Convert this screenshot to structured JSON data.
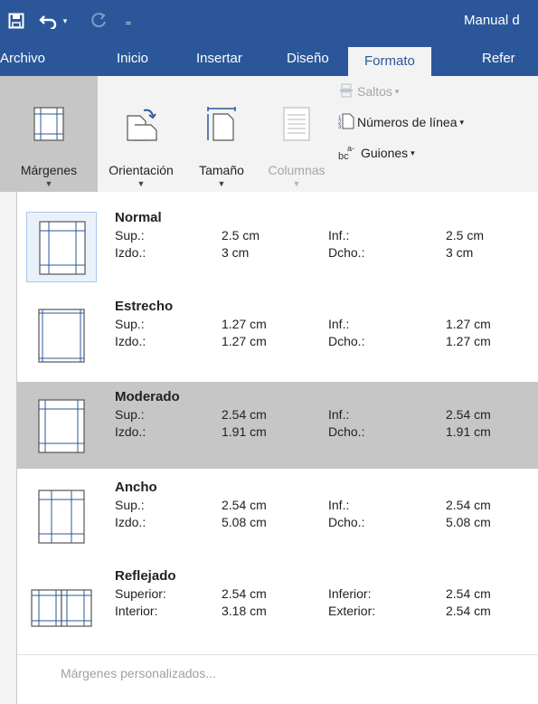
{
  "quick_access": {
    "save_icon": "save-icon",
    "undo_icon": "undo-icon",
    "redo_icon": "redo-icon",
    "customize_icon": "customize-icon"
  },
  "window": {
    "document_title": "Manual d"
  },
  "tabs": [
    {
      "label": "Archivo"
    },
    {
      "label": "Inicio"
    },
    {
      "label": "Insertar"
    },
    {
      "label": "Diseño"
    },
    {
      "label": "Formato"
    },
    {
      "label": "Refer"
    }
  ],
  "ribbon": {
    "margenes": "Márgenes",
    "orientacion": "Orientación",
    "tamano": "Tamaño",
    "columnas": "Columnas",
    "saltos": "Saltos",
    "numeros_linea": "Números de línea",
    "guiones": "Guiones"
  },
  "margins_menu": {
    "options": [
      {
        "title": "Normal",
        "label_top": "Sup.:",
        "top": "2.5 cm",
        "label_bottom": "Inf.:",
        "bottom": "2.5 cm",
        "label_left": "Izdo.:",
        "left": "3 cm",
        "label_right": "Dcho.:",
        "right": "3 cm"
      },
      {
        "title": "Estrecho",
        "label_top": "Sup.:",
        "top": "1.27 cm",
        "label_bottom": "Inf.:",
        "bottom": "1.27 cm",
        "label_left": "Izdo.:",
        "left": "1.27 cm",
        "label_right": "Dcho.:",
        "right": "1.27 cm"
      },
      {
        "title": "Moderado",
        "label_top": "Sup.:",
        "top": "2.54 cm",
        "label_bottom": "Inf.:",
        "bottom": "2.54 cm",
        "label_left": "Izdo.:",
        "left": "1.91 cm",
        "label_right": "Dcho.:",
        "right": "1.91 cm"
      },
      {
        "title": "Ancho",
        "label_top": "Sup.:",
        "top": "2.54 cm",
        "label_bottom": "Inf.:",
        "bottom": "2.54 cm",
        "label_left": "Izdo.:",
        "left": "5.08 cm",
        "label_right": "Dcho.:",
        "right": "5.08 cm"
      },
      {
        "title": "Reflejado",
        "label_top": "Superior:",
        "top": "2.54 cm",
        "label_bottom": "Inferior:",
        "bottom": "2.54 cm",
        "label_left": "Interior:",
        "left": "3.18 cm",
        "label_right": "Exterior:",
        "right": "2.54 cm"
      }
    ],
    "custom_label": "Márgenes personalizados..."
  },
  "colors": {
    "brand": "#2b579a",
    "ribbon_bg": "#f3f3f3",
    "hover_bg": "#c6c6c6",
    "selected_thumb_bg": "#e9f1fb"
  }
}
